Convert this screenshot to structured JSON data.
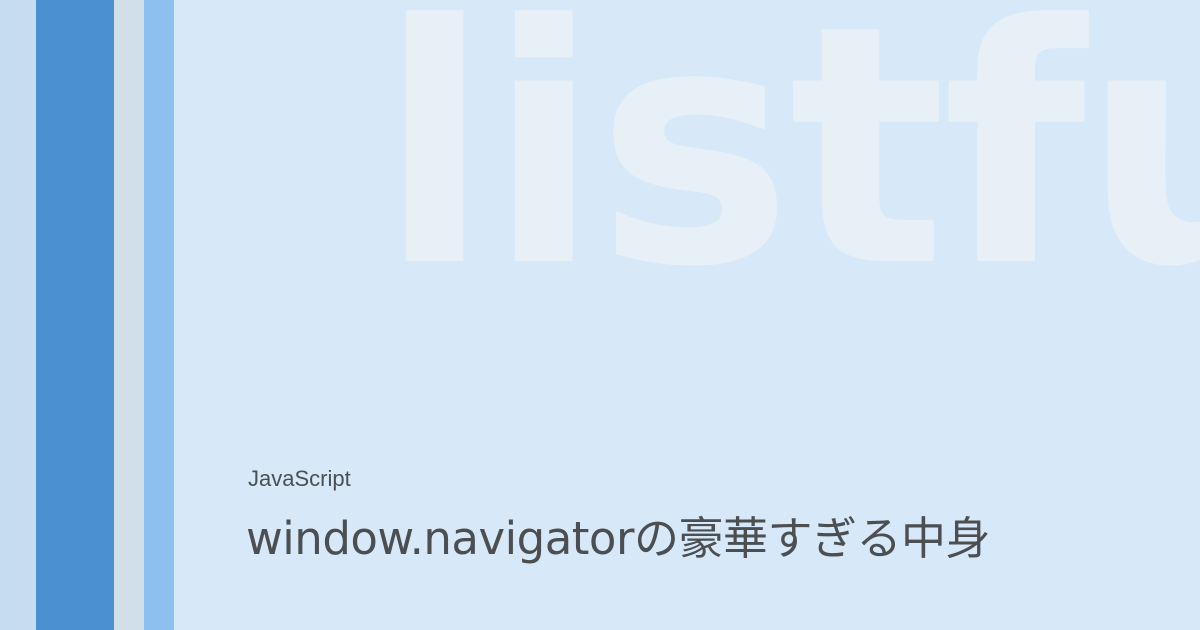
{
  "watermark": {
    "text": "listful"
  },
  "post": {
    "category": "JavaScript",
    "title": "window.navigatorの豪華すぎる中身"
  },
  "colors": {
    "background": "#d7e8f8",
    "stripe_1": "#c6dcef",
    "stripe_2": "#4b90d0",
    "stripe_3": "#d2dfe9",
    "stripe_4": "#8cc0ee",
    "watermark": "#e7eff7",
    "text": "#4b4f52"
  }
}
